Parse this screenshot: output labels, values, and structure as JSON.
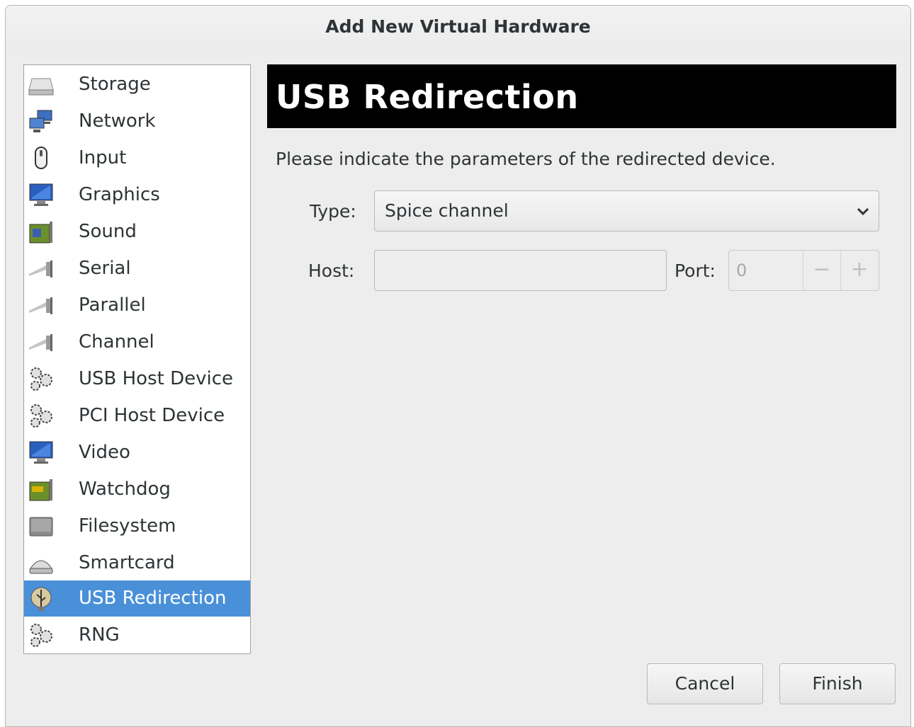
{
  "window": {
    "title": "Add New Virtual Hardware"
  },
  "sidebar": {
    "items": [
      {
        "label": "Storage",
        "icon": "storage-icon"
      },
      {
        "label": "Network",
        "icon": "network-icon"
      },
      {
        "label": "Input",
        "icon": "mouse-icon"
      },
      {
        "label": "Graphics",
        "icon": "monitor-icon"
      },
      {
        "label": "Sound",
        "icon": "sound-card-icon"
      },
      {
        "label": "Serial",
        "icon": "serial-cable-icon"
      },
      {
        "label": "Parallel",
        "icon": "parallel-cable-icon"
      },
      {
        "label": "Channel",
        "icon": "channel-cable-icon"
      },
      {
        "label": "USB Host Device",
        "icon": "gears-icon"
      },
      {
        "label": "PCI Host Device",
        "icon": "gears-icon"
      },
      {
        "label": "Video",
        "icon": "monitor-icon"
      },
      {
        "label": "Watchdog",
        "icon": "watchdog-card-icon"
      },
      {
        "label": "Filesystem",
        "icon": "filesystem-icon"
      },
      {
        "label": "Smartcard",
        "icon": "smartcard-icon"
      },
      {
        "label": "USB Redirection",
        "icon": "usb-icon",
        "selected": true
      },
      {
        "label": "RNG",
        "icon": "gears-icon"
      }
    ]
  },
  "main": {
    "header_title": "USB Redirection",
    "description": "Please indicate the parameters of the redirected device.",
    "type_label": "Type:",
    "type_value": "Spice channel",
    "host_label": "Host:",
    "host_value": "",
    "port_label": "Port:",
    "port_value": "0",
    "spin_minus": "−",
    "spin_plus": "+"
  },
  "buttons": {
    "cancel": "Cancel",
    "finish": "Finish"
  },
  "colors": {
    "selection": "#4a90d9",
    "window_bg": "#ededed",
    "banner_bg": "#000000"
  }
}
